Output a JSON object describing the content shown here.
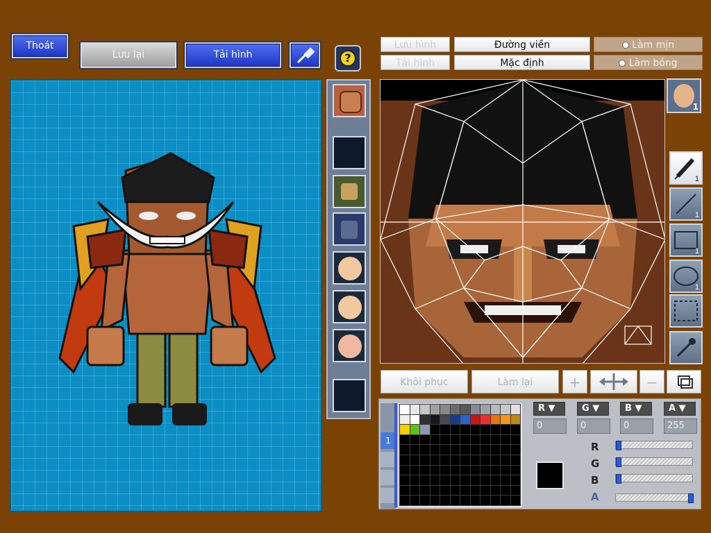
{
  "toolbar": {
    "exit_label": "Thoát",
    "save_label": "Lưu lại",
    "load_label": "Tải hình",
    "help_glyph": "?"
  },
  "editor_toolbar": {
    "save_image": "Lưu hình",
    "load_image": "Tải hình",
    "outline": "Đường viền",
    "default": "Mặc định",
    "smooth": "Làm mịn",
    "shade": "Làm bóng"
  },
  "bottom_buttons": {
    "restore": "Khôi phục",
    "redo": "Làm lại",
    "plus": "+",
    "minus": "−"
  },
  "tools": [
    {
      "name": "pen",
      "count": "1"
    },
    {
      "name": "line",
      "count": "1"
    },
    {
      "name": "rectangle",
      "count": "1"
    },
    {
      "name": "ellipse",
      "count": "1"
    },
    {
      "name": "selection",
      "count": ""
    },
    {
      "name": "eyedropper",
      "count": ""
    }
  ],
  "preview_count": "1",
  "color": {
    "headers": [
      "R",
      "G",
      "B",
      "A"
    ],
    "values": [
      "0",
      "0",
      "0",
      "255"
    ],
    "sliders": {
      "r": 0,
      "g": 0,
      "b": 0,
      "a": 255
    },
    "current": "#000000"
  },
  "palette_tab": "1",
  "palette_colors": [
    "#ffffff",
    "#e8e8e8",
    "#c8c8c8",
    "#a0a0a0",
    "#888888",
    "#6c6c6c",
    "#585858",
    "#888890",
    "#a0a0a8",
    "#b8b8c0",
    "#c8c8c8",
    "#e0e0e0",
    "#f0f0e8",
    "#ffffff",
    "#303030",
    "#181818",
    "#484850",
    "#1a3a8a",
    "#3060c0",
    "#c01818",
    "#e83030",
    "#e07818",
    "#f09820",
    "#b88818",
    "#f0d000",
    "#60c020",
    "#9098b0"
  ],
  "parts_strip": [
    {
      "icon": "head-icon"
    },
    {
      "icon": "empty"
    },
    {
      "icon": "horns-icon"
    },
    {
      "icon": "body-icon"
    },
    {
      "icon": "face-icon"
    },
    {
      "icon": "face-icon"
    },
    {
      "icon": "face-icon"
    },
    {
      "icon": "empty"
    }
  ]
}
